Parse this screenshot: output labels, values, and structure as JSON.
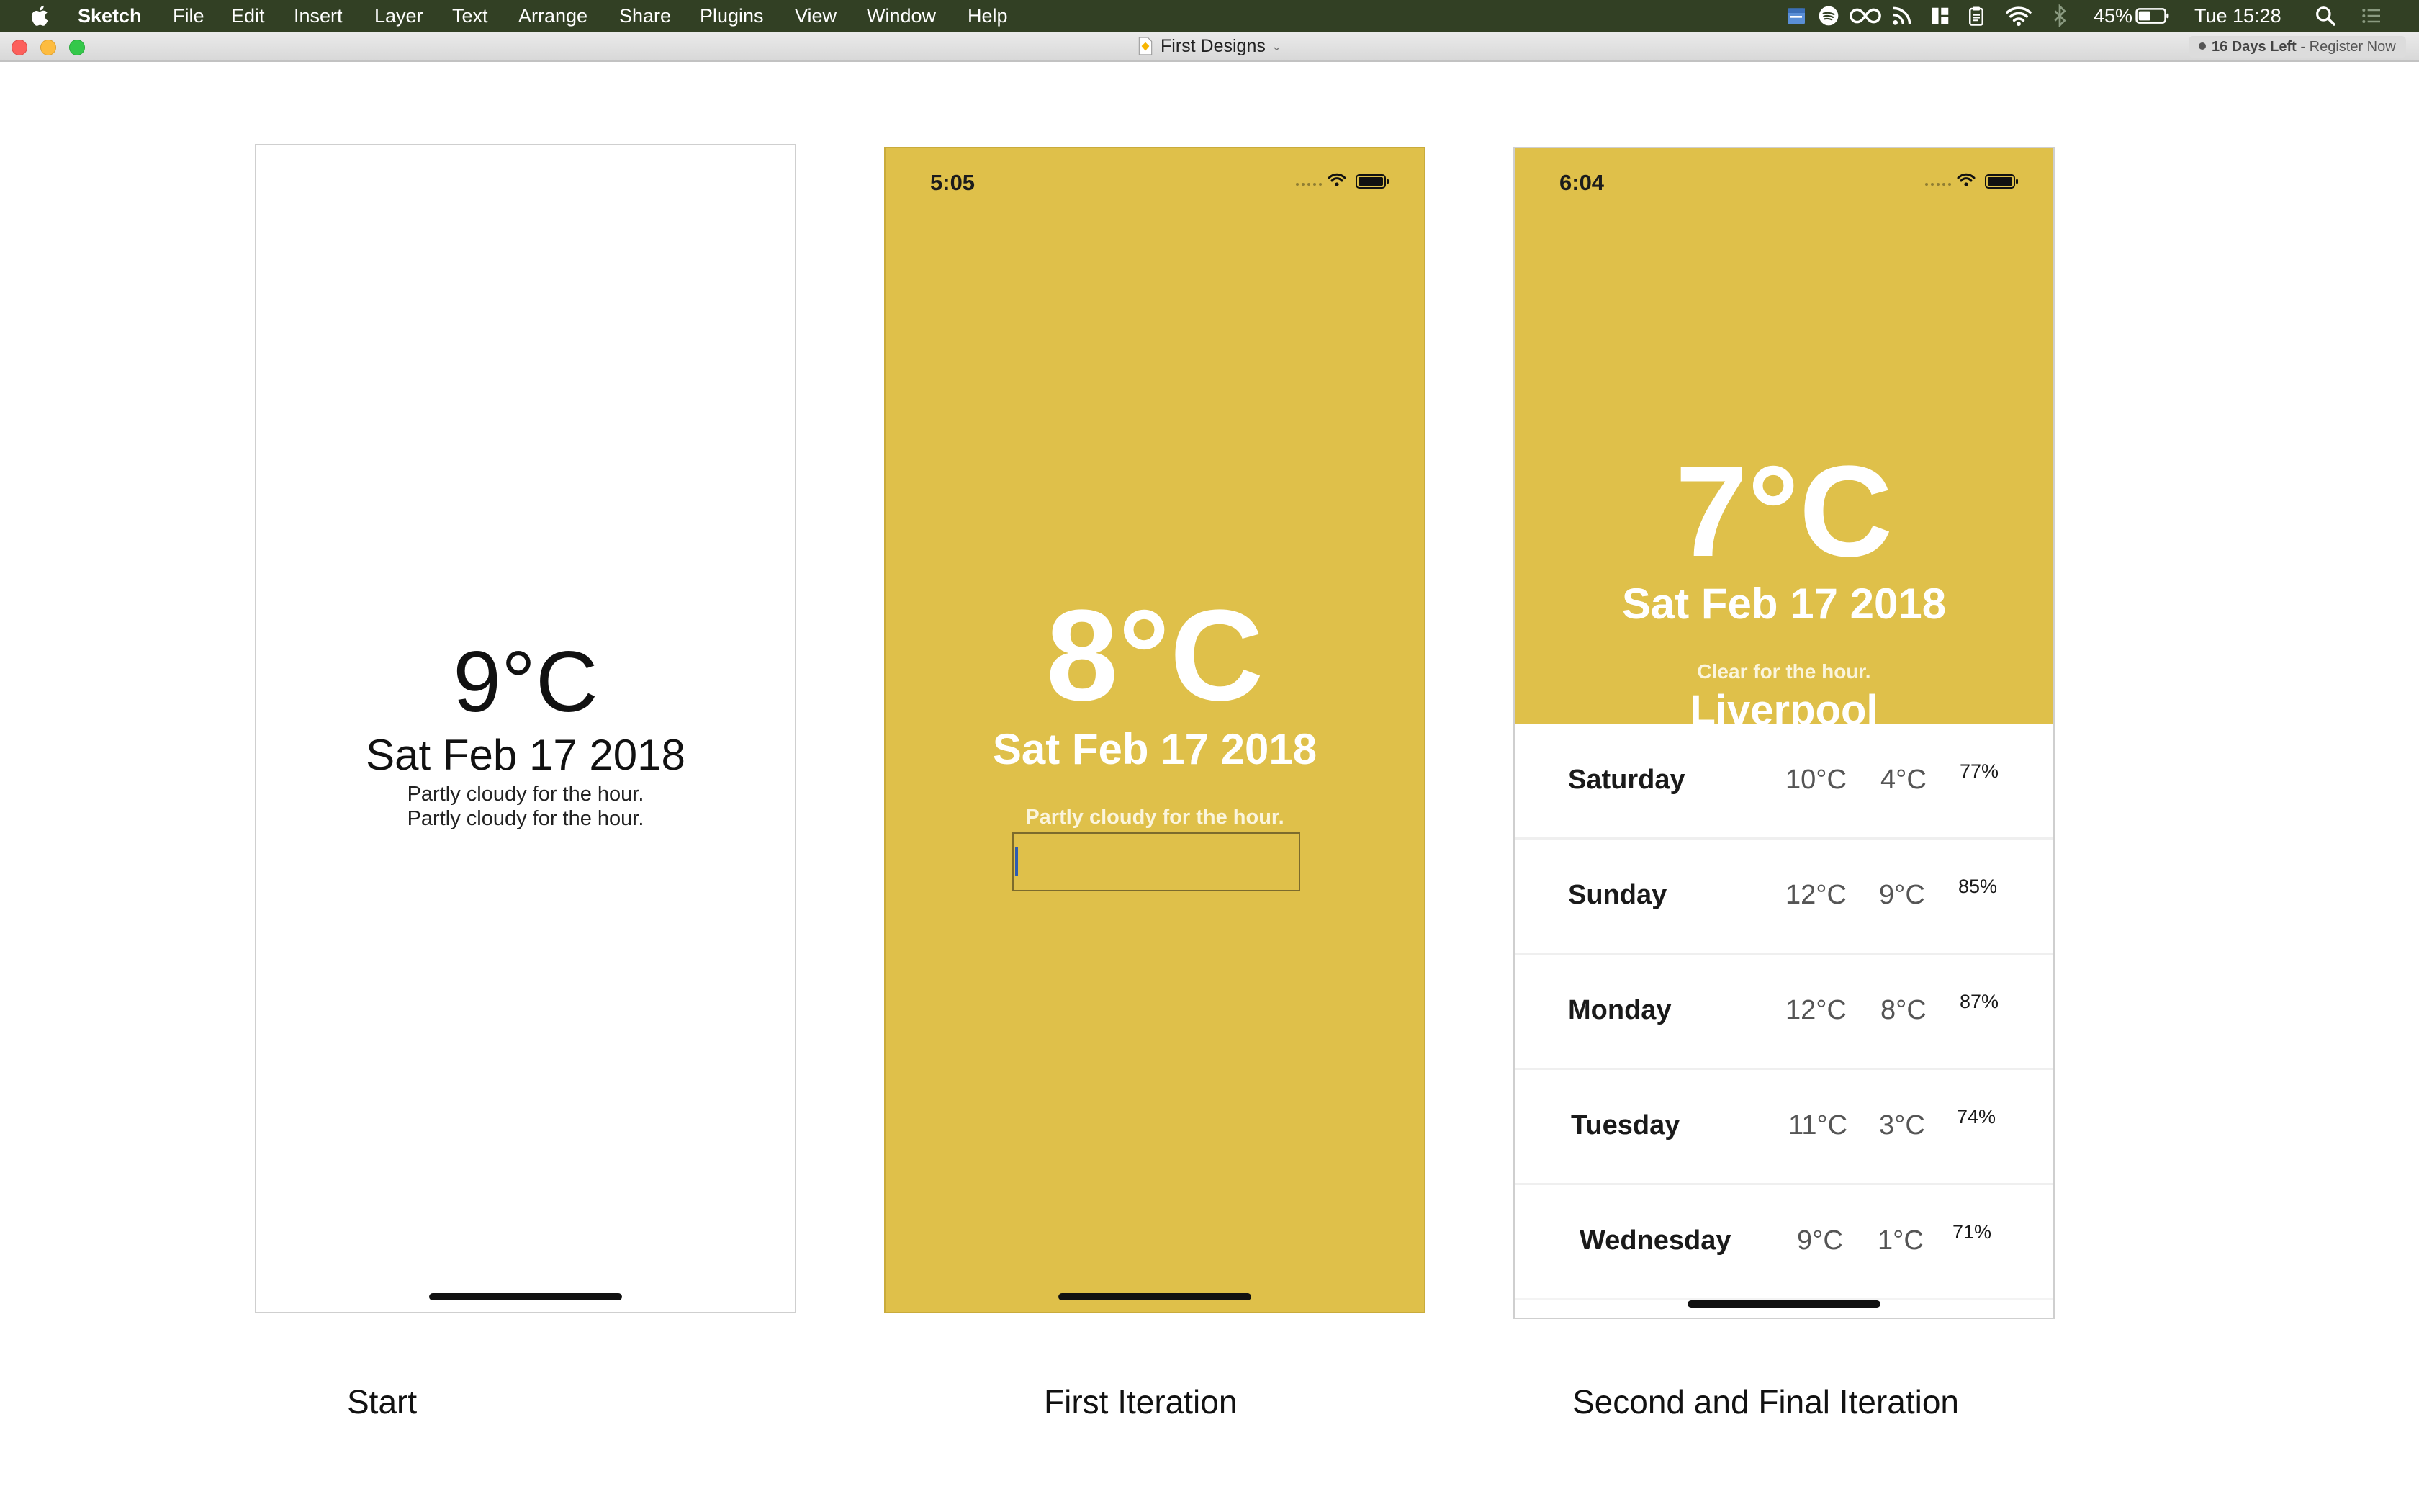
{
  "menubar": {
    "app_name": "Sketch",
    "items": [
      "File",
      "Edit",
      "Insert",
      "Layer",
      "Text",
      "Arrange",
      "Share",
      "Plugins",
      "View",
      "Window",
      "Help"
    ],
    "battery": "45%",
    "clock": "Tue 15:28",
    "status_icons": [
      "calendar-icon",
      "spotify-icon",
      "infinity-icon",
      "rss-icon",
      "grid-icon",
      "clipboard-icon",
      "wifi-icon",
      "bluetooth-icon",
      "battery-icon",
      "spotlight-icon",
      "notification-center-icon"
    ]
  },
  "window": {
    "document_title": "First Designs",
    "trial_days": "16 Days Left",
    "trial_separator": "-",
    "trial_action": "Register Now"
  },
  "artboards": {
    "start": {
      "temperature": "9°C",
      "date": "Sat Feb 17 2018",
      "summary_1": "Partly cloudy for the hour.",
      "summary_2": "Partly cloudy for the hour."
    },
    "first": {
      "time": "5:05",
      "temperature": "8°C",
      "date": "Sat Feb 17 2018",
      "summary": "Partly cloudy for the hour.",
      "background_color": "#dfc04a"
    },
    "final": {
      "time": "6:04",
      "temperature": "7°C",
      "date": "Sat Feb 17 2018",
      "summary": "Clear for the hour.",
      "city": "Liverpool",
      "forecast": [
        {
          "day": "Saturday",
          "high": "10°C",
          "low": "4°C",
          "humidity": "77%"
        },
        {
          "day": "Sunday",
          "high": "12°C",
          "low": "9°C",
          "humidity": "85%"
        },
        {
          "day": "Monday",
          "high": "12°C",
          "low": "8°C",
          "humidity": "87%"
        },
        {
          "day": "Tuesday",
          "high": "11°C",
          "low": "3°C",
          "humidity": "74%"
        },
        {
          "day": "Wednesday",
          "high": "9°C",
          "low": "1°C",
          "humidity": "71%"
        }
      ]
    }
  },
  "captions": {
    "start": "Start",
    "first": "First Iteration",
    "final": "Second and Final Iteration"
  }
}
